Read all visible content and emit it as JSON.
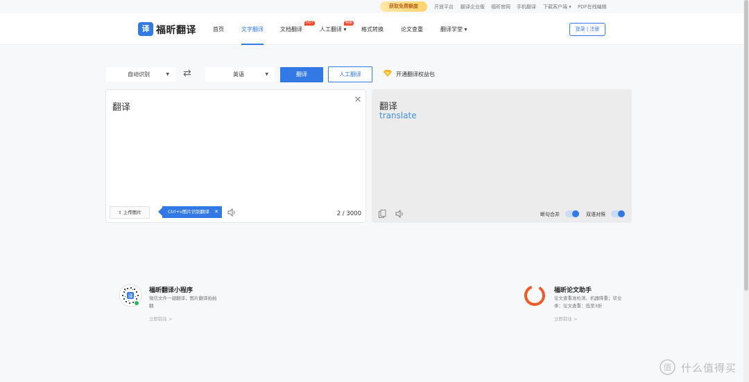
{
  "topbar": {
    "promo": "获取免费额度",
    "links": [
      "开放平台",
      "翻译企业版",
      "福昕官网",
      "手机翻译",
      "下载客户端",
      "PDF在线编辑"
    ]
  },
  "header": {
    "logo_mark": "译",
    "logo_text": "福昕翻译",
    "nav": [
      "首页",
      "文字翻译",
      "文档翻译",
      "人工翻译",
      "格式转换",
      "论文查重",
      "翻译学堂"
    ],
    "nav_active": "文字翻译",
    "badge_hot": "HOT",
    "badge_special": "特惠",
    "login": "登录 | 注册",
    "accent": "#3279e6"
  },
  "toolbar": {
    "source_lang": "自动识别",
    "target_lang": "英语",
    "swap_icon": "swap-arrows-icon",
    "translate_btn": "翻译",
    "human_btn": "人工翻译",
    "vip_text": "开通翻译权益包"
  },
  "source_panel": {
    "text": "翻译",
    "upload_btn": "上传图片",
    "tip": "Ctrl+v图片识别翻译",
    "counter": "2 / 3000"
  },
  "target_panel": {
    "source_echo": "翻译",
    "result": "translate",
    "merge_label": "断句合并",
    "bilingual_label": "双语对照",
    "merge_on": true,
    "bilingual_on": true
  },
  "footer": {
    "left_title": "福昕翻译小程序",
    "left_desc": "微信文件一键翻译，图片翻译拍拍翻",
    "left_link": "立即前往 >",
    "right_title": "福昕论文助手",
    "right_desc": "论文查重准检测、机器降重；毕业季：论文查重：低至3折",
    "right_link": "立即前往 >"
  },
  "watermark": "什么值得买"
}
